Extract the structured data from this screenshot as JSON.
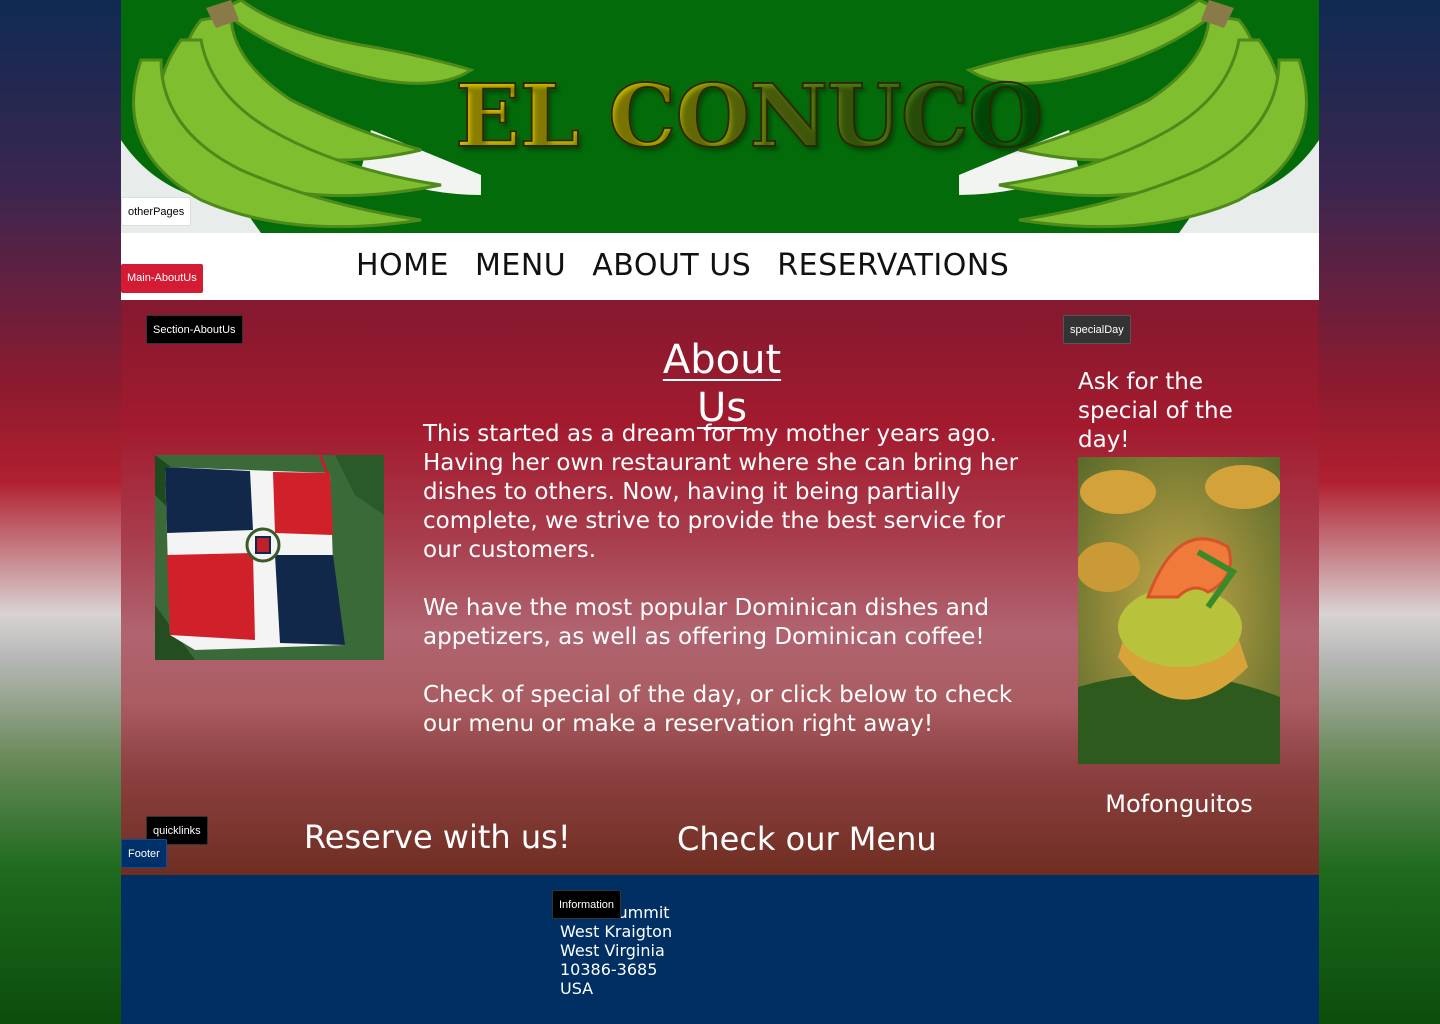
{
  "header": {
    "logo_text": "EL CONUCO"
  },
  "nav": {
    "items": [
      {
        "label": "HOME"
      },
      {
        "label": "MENU"
      },
      {
        "label": "ABOUT US"
      },
      {
        "label": "RESERVATIONS"
      }
    ]
  },
  "tags": {
    "other_pages": "otherPages",
    "main_about": "Main-AboutUs",
    "section_about": "Section-AboutUs",
    "special_day": "specialDay",
    "quicklinks": "quicklinks",
    "footer": "Footer",
    "information": "Information"
  },
  "about": {
    "heading": "About Us",
    "paragraphs": [
      "This started as a dream for my mother years ago. Having her own restaurant where she can bring her dishes to others. Now, having it being partially complete, we strive to provide the best service for our customers.",
      "We have the most popular Dominican dishes and appetizers, as well as offering Dominican coffee!",
      "Check of special of the day, or click below to check our menu or make a reservation right away!"
    ]
  },
  "special": {
    "title": "Ask for the special of the day!",
    "caption": "Mofonguitos"
  },
  "quicklinks": {
    "reserve": "Reserve with us!",
    "menu": "Check our Menu"
  },
  "footer": {
    "address_lines": [
      "elsea Summit",
      "West Kraigton",
      "West Virginia",
      "10386-3685",
      "USA"
    ]
  },
  "colors": {
    "banner_green": "#036b0a",
    "footer_navy": "#002f63",
    "main_red": "#a31a2e",
    "tag_red": "#d41b34"
  }
}
